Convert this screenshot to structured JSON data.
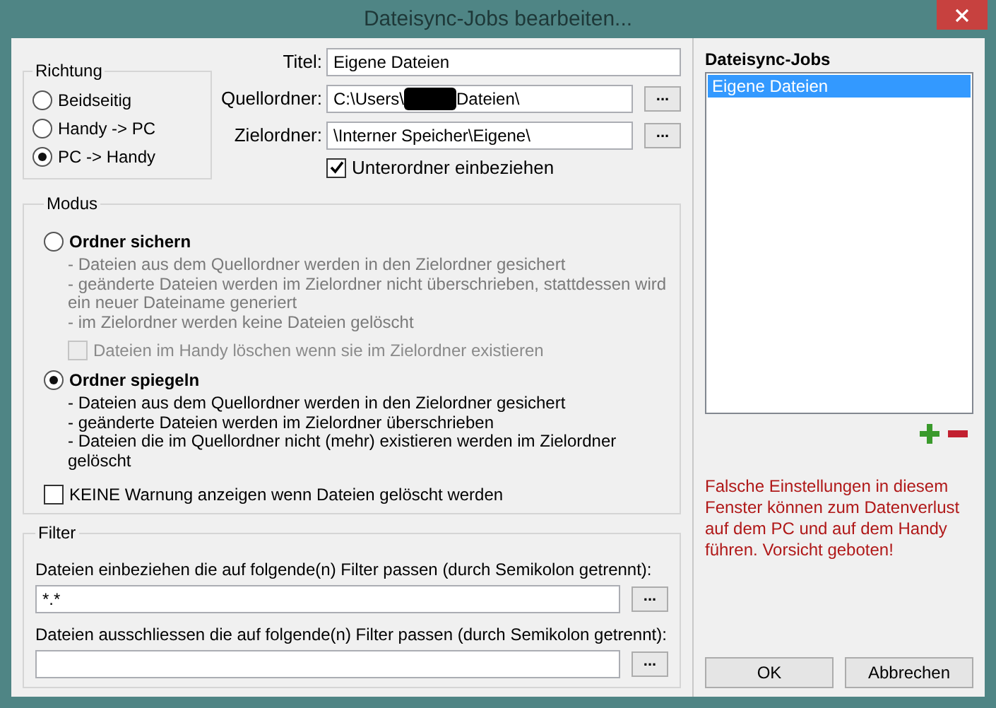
{
  "window": {
    "title": "Dateisync-Jobs bearbeiten..."
  },
  "direction": {
    "label": "Richtung",
    "options": [
      {
        "label": "Beidseitig",
        "selected": false
      },
      {
        "label": "Handy -> PC",
        "selected": false
      },
      {
        "label": "PC -> Handy",
        "selected": true
      }
    ]
  },
  "fields": [
    {
      "label": "Titel:",
      "segments": [
        "Eigene Dateien"
      ]
    },
    {
      "label": "Quellordner:",
      "segments": [
        "C:\\Users\\",
        "Dateien\\"
      ],
      "browse_label": "..."
    },
    {
      "label": "Zielordner:",
      "segments": [
        "\\Interner Speicher\\Eigene\\"
      ],
      "browse_label": "..."
    }
  ],
  "subfolders": {
    "label": "Unterordner einbeziehen",
    "checked": true
  },
  "mode": {
    "label": "Modus",
    "options": [
      {
        "label": "Ordner sichern",
        "selected": false,
        "lines": [
          "- Dateien aus dem Quellordner werden in den Zielordner gesichert",
          "- geänderte Dateien werden im Zielordner nicht überschrieben, stattdessen wird ein neuer Dateiname generiert",
          "- im Zielordner werden keine Dateien gelöscht"
        ],
        "suboption": {
          "label": "Dateien im Handy löschen wenn sie im Zielordner existieren",
          "checked": false,
          "disabled": true
        }
      },
      {
        "label": "Ordner spiegeln",
        "selected": true,
        "lines": [
          "- Dateien aus dem Quellordner werden in den Zielordner gesichert",
          "- geänderte Dateien werden im Zielordner überschrieben",
          "- Dateien die im Quellordner nicht (mehr) existieren werden im Zielordner gelöscht"
        ]
      }
    ],
    "no_warning": {
      "label": "KEINE Warnung anzeigen wenn Dateien gelöscht werden",
      "checked": false
    }
  },
  "filter": {
    "label": "Filter",
    "rows": [
      {
        "label": "Dateien einbeziehen die auf folgende(n) Filter passen (durch Semikolon getrennt):",
        "value": "*.*",
        "browse_label": "..."
      },
      {
        "label": "Dateien ausschliessen die auf folgende(n) Filter passen (durch Semikolon getrennt):",
        "browse_label": "..."
      }
    ]
  },
  "jobs": {
    "label": "Dateisync-Jobs",
    "items": [
      {
        "label": "Eigene Dateien",
        "selected": true
      }
    ]
  },
  "warning": "Falsche Einstellungen in diesem Fenster können zum Datenverlust auf dem PC und auf dem Handy führen. Vorsicht geboten!",
  "buttons": [
    "OK",
    "Abbrechen"
  ]
}
